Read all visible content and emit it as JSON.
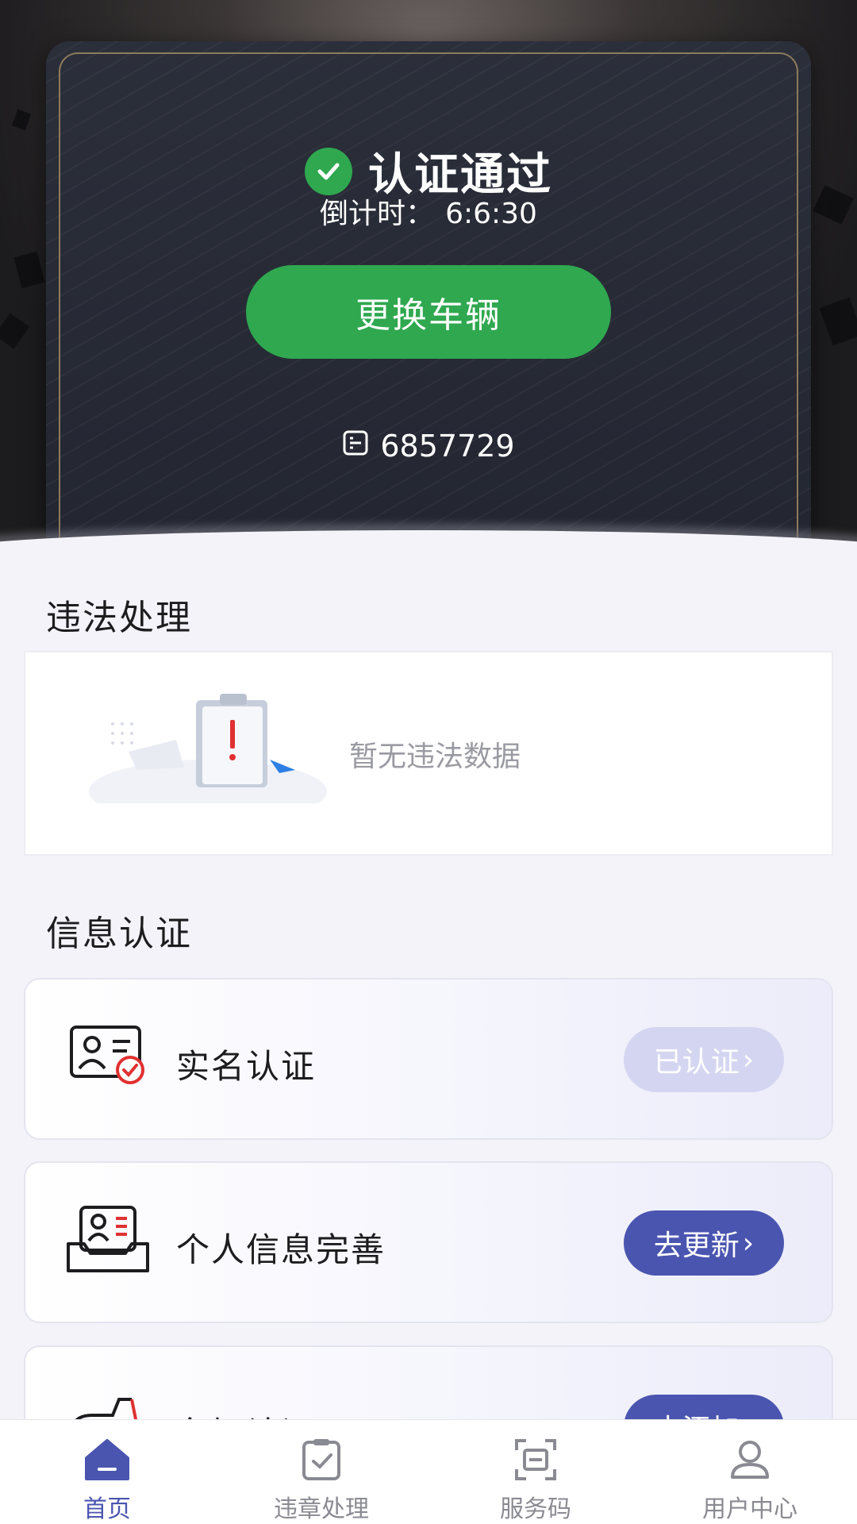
{
  "header": {
    "status_title": "认证通过",
    "countdown_label": "倒计时：",
    "countdown_value": "6:6:30",
    "change_vehicle_label": "更换车辆",
    "plate_number": "6857729"
  },
  "violations": {
    "section_title": "违法处理",
    "empty_text": "暂无违法数据"
  },
  "info_auth": {
    "section_title": "信息认证",
    "items": [
      {
        "label": "实名认证",
        "button": "已认证",
        "state": "done"
      },
      {
        "label": "个人信息完善",
        "button": "去更新",
        "state": "action"
      },
      {
        "label": "车辆认证",
        "button": "去添加",
        "state": "action"
      }
    ]
  },
  "tabbar": {
    "items": [
      {
        "label": "首页",
        "icon": "home-icon",
        "active": true
      },
      {
        "label": "违章处理",
        "icon": "clipboard-check-icon",
        "active": false
      },
      {
        "label": "服务码",
        "icon": "scan-code-icon",
        "active": false
      },
      {
        "label": "用户中心",
        "icon": "user-icon",
        "active": false
      }
    ]
  },
  "colors": {
    "green": "#2fa84f",
    "accent": "#4a55b0",
    "pill_done": "#d4d6f1"
  }
}
